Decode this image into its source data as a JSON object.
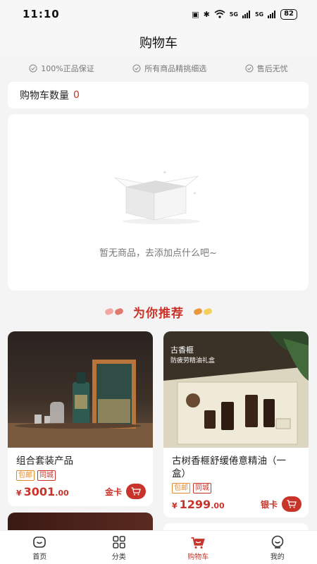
{
  "status": {
    "time": "11:10",
    "battery": "82",
    "signal1": "5G",
    "signal2": "5G"
  },
  "header": {
    "title": "购物车"
  },
  "guarantees": [
    "100%正品保证",
    "所有商品精挑细选",
    "售后无忧"
  ],
  "cart": {
    "count_label": "购物车数量",
    "count": "0"
  },
  "empty": {
    "text": "暂无商品，去添加点什么吧~"
  },
  "recommend": {
    "title": "为你推荐"
  },
  "products": [
    {
      "name": "组合套装产品",
      "tags": [
        "包邮",
        "同城"
      ],
      "currency": "¥",
      "price_int": "3001",
      "price_dec": ".00",
      "member": "金卡"
    },
    {
      "name": "古树香榧舒缓倦意精油（一盒）",
      "tags": [
        "包邮",
        "同城"
      ],
      "currency": "¥",
      "price_int": "1299",
      "price_dec": ".00",
      "member": "银卡",
      "image_caption_1": "古香榧",
      "image_caption_2": "防疲劳精油礼盒"
    }
  ],
  "tabs": [
    {
      "label": "首页",
      "icon": "home-icon"
    },
    {
      "label": "分类",
      "icon": "category-icon"
    },
    {
      "label": "购物车",
      "icon": "cart-icon",
      "active": true
    },
    {
      "label": "我的",
      "icon": "profile-icon"
    }
  ],
  "colors": {
    "accent": "#c9342a",
    "tag": "#e08a2b",
    "bg": "#f4f4f4"
  }
}
